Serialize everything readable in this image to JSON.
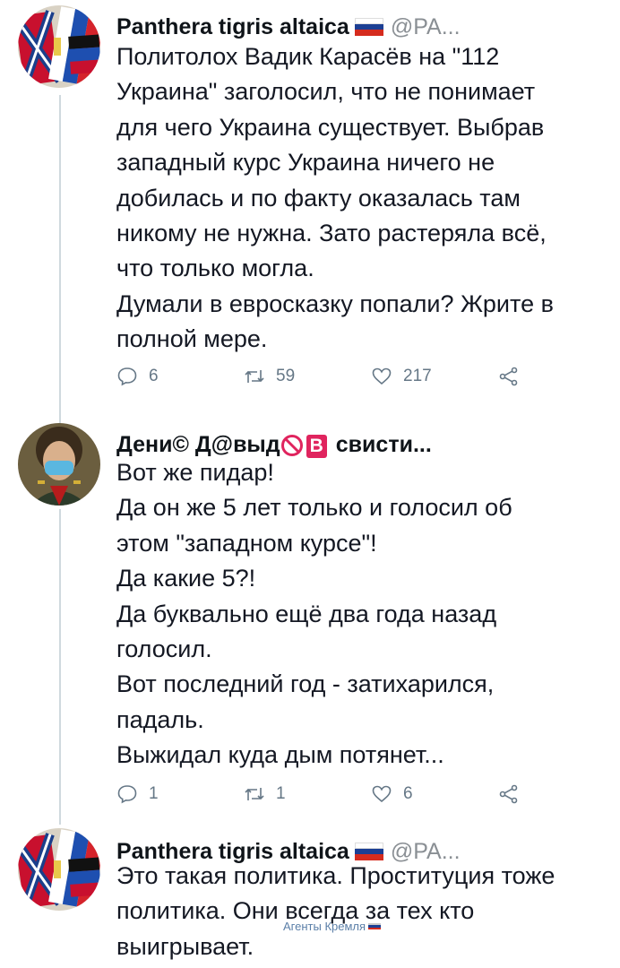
{
  "tweets": [
    {
      "name": "Panthera tigris altaica",
      "handle": "@PA...",
      "lines": [
        "Политолох Вадик Карасёв на \"112",
        "Украина\" заголосил, что не понимает",
        "для чего Украина существует. Выбрав",
        "западный курс Украина ничего не",
        "добилась и по факту  оказалась там",
        "никому не нужна. Зато растеряла всё,",
        "что только могла.",
        "Думали в евросказку попали? Жрите в",
        "полной мере."
      ],
      "replies": "6",
      "retweets": "59",
      "likes": "217"
    },
    {
      "name_part1": "Дени",
      "name_copyright": "©",
      "name_part2": "Д@выд",
      "name_badge": "В",
      "name_part3": "свисти...",
      "lines": [
        "Вот же пидар!",
        "Да он же 5 лет только и голосил об",
        "этом \"западном курсе\"!",
        "Да какие 5?!",
        "Да буквально ещё два года назад",
        "голосил.",
        "Вот последний год - затихарился,",
        "падаль.",
        "Выжидал куда дым потянет..."
      ],
      "replies": "1",
      "retweets": "1",
      "likes": "6"
    },
    {
      "name": "Panthera tigris altaica",
      "handle": "@PA...",
      "lines": [
        "Это такая политика. Проституция тоже",
        "политика. Они всегда за тех кто",
        "выигрывает."
      ]
    }
  ],
  "watermark": "Агенты Кремля",
  "colors": {
    "text": "#141823",
    "muted": "#657786",
    "thread_line": "#cfd9de",
    "badge": "#e0245e"
  },
  "icons": [
    "reply-icon",
    "retweet-icon",
    "like-icon",
    "share-icon",
    "russia-flag-icon",
    "no-entry-icon"
  ]
}
